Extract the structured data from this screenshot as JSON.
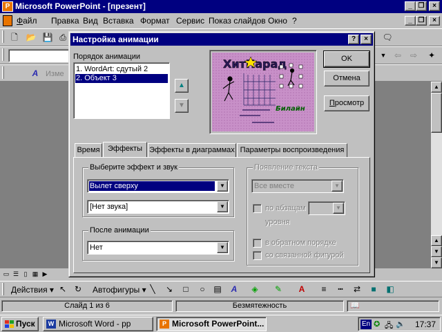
{
  "app": {
    "title": "Microsoft PowerPoint - [презент]",
    "menu": [
      "Файл",
      "Правка",
      "Вид",
      "Вставка",
      "Формат",
      "Сервис",
      "Показ слайдов",
      "Окно",
      "?"
    ],
    "draw_toolbar": {
      "actions_label": "Действия",
      "autoshapes_label": "Автофигуры"
    },
    "format_toolbar_text": "Изме",
    "status": {
      "slide": "Слайд 1 из 6",
      "template": "Безмятежность"
    }
  },
  "dialog": {
    "title": "Настройка анимации",
    "help_btn": "?",
    "close_btn": "×",
    "order_label": "Порядок анимации",
    "order_items": [
      "1. WordArt: сдутый 2",
      "2. Объект 3"
    ],
    "ok": "OK",
    "cancel": "Отмена",
    "preview": "Просмотр",
    "tabs": [
      "Время",
      "Эффекты",
      "Эффекты в диаграммах",
      "Параметры воспроизведения"
    ],
    "effects": {
      "choose_title": "Выберите эффект и звук",
      "effect_value": "Вылет сверху",
      "sound_value": "[Нет звука]",
      "after_title": "После анимации",
      "after_value": "Нет",
      "text_title": "Появление текста",
      "text_value": "Все вместе",
      "by_paragraph": "по абзацам",
      "levels": "уровня",
      "reverse_order": "в обратном порядке",
      "with_shape": "со связанной фигурой"
    },
    "preview_slide": {
      "title": "ХитПарад",
      "subtitle": "Билайн"
    }
  },
  "taskbar": {
    "start": "Пуск",
    "tasks": [
      "Microsoft Word - pp",
      "Microsoft PowerPoint..."
    ],
    "lang": "En",
    "time": "17:37"
  },
  "colors": {
    "titlebar": "#000080",
    "face": "#c0c0c0",
    "desktop": "#008080",
    "slide_bg": "#c890c8"
  }
}
